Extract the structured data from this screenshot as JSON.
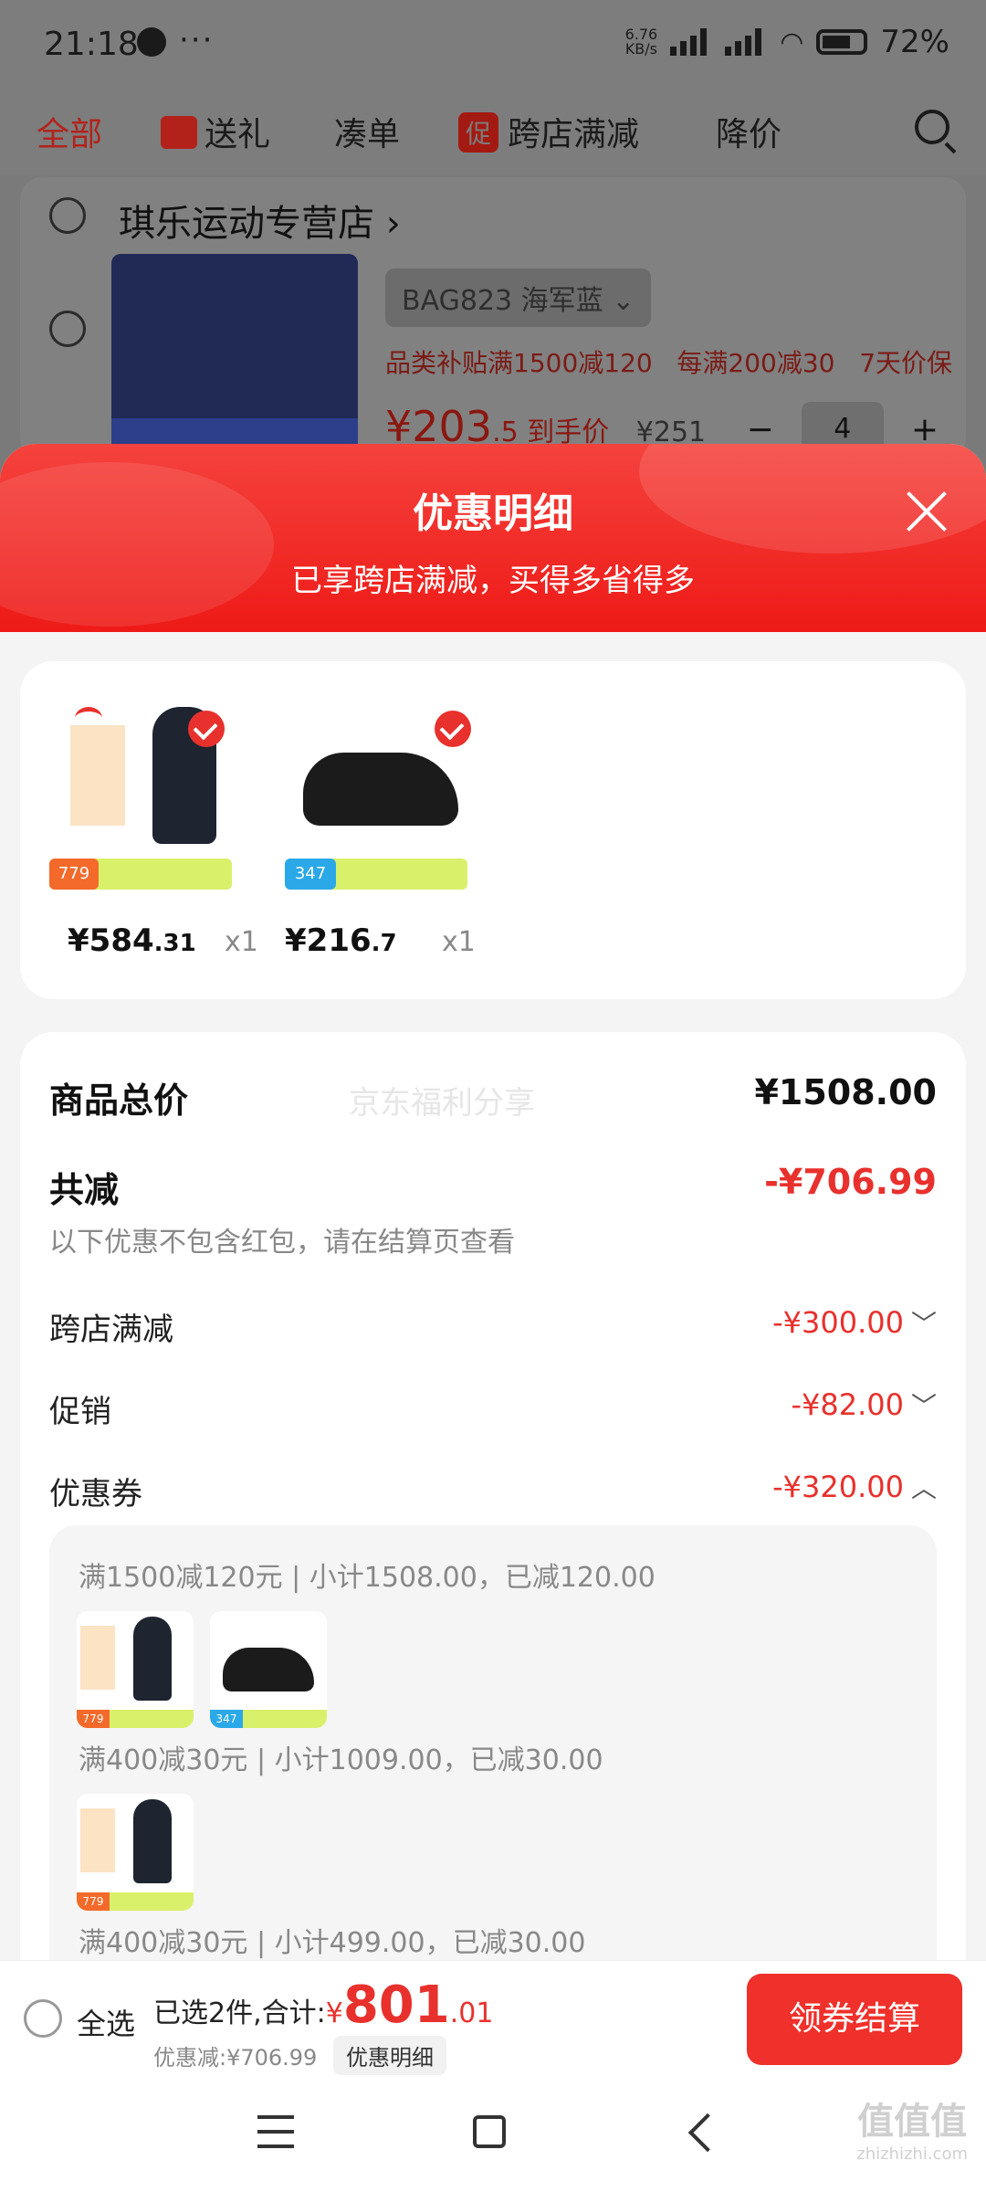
{
  "status_bar": {
    "time": "21:18",
    "more": "···",
    "net_speed": "6.76",
    "net_unit": "KB/s",
    "battery": "72%"
  },
  "tabs": [
    {
      "label": "全部"
    },
    {
      "label": "送礼"
    },
    {
      "label": "凑单"
    },
    {
      "label": "跨店满减",
      "badge": "促"
    },
    {
      "label": "降价"
    }
  ],
  "cart": {
    "shop_name": "琪乐运动专营店",
    "item": {
      "variant": "BAG823 海军蓝",
      "promo1": "品类补贴满1500减120",
      "promo2": "每满200减30",
      "promo3": "7天价保",
      "price_int": "¥203",
      "price_dec": ".5",
      "price_suffix": "到手价",
      "old_price": "¥251",
      "qty": "4",
      "minus": "−",
      "plus": "+"
    }
  },
  "sheet": {
    "title": "优惠明细",
    "subtitle": "已享跨店满减，买得多省得多",
    "products": [
      {
        "price_int": "¥584",
        "price_dec": ".31",
        "qty": "x1",
        "banner_price": "779"
      },
      {
        "price_int": "¥216",
        "price_dec": ".7",
        "qty": "x1",
        "banner_price": "347"
      }
    ],
    "watermark": "京东福利分享",
    "summary": {
      "total_label": "商品总价",
      "total_value": "¥1508.00",
      "discount_label": "共减",
      "discount_value": "-¥706.99",
      "discount_hint": "以下优惠不包含红包，请在结算页查看",
      "rows": [
        {
          "label": "跨店满减",
          "value": "-¥300.00",
          "chevron": "﹀"
        },
        {
          "label": "促销",
          "value": "-¥82.00",
          "chevron": "﹀"
        },
        {
          "label": "优惠券",
          "value": "-¥320.00",
          "chevron": "︿"
        }
      ],
      "coupons": [
        "满1500减120元 | 小计1508.00，已减120.00",
        "满400减30元 | 小计1009.00，已减30.00",
        "满400减30元 | 小计499.00，已减30.00"
      ]
    }
  },
  "bottom_bar": {
    "select_all": "全选",
    "selected_text": "已选2件,合计:",
    "yen": "¥",
    "total_int": "801",
    "total_dec": ".01",
    "discount_text": "优惠减:¥706.99",
    "detail_chip": "优惠明细",
    "checkout": "领券结算"
  },
  "watermark_site": {
    "main": "值值值",
    "sub": "zhizhizhi.com"
  }
}
